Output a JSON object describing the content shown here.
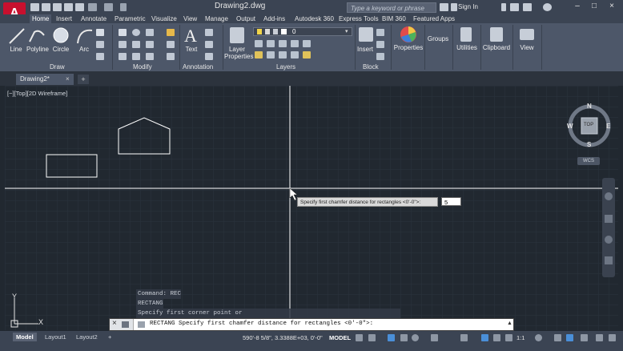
{
  "app": {
    "logo_letter": "A",
    "document_title": "Drawing2.dwg",
    "search_placeholder": "Type a keyword or phrase",
    "signin_label": "Sign In"
  },
  "ribbon_tabs": [
    "Home",
    "Insert",
    "Annotate",
    "Parametric",
    "Visualize",
    "View",
    "Manage",
    "Output",
    "Add-ins",
    "Autodesk 360",
    "Express Tools",
    "BIM 360",
    "Featured Apps"
  ],
  "active_ribbon_tab": "Home",
  "draw_panel": {
    "tools": [
      "Line",
      "Polyline",
      "Circle",
      "Arc"
    ],
    "title": "Draw"
  },
  "modify_panel": {
    "title": "Modify"
  },
  "annotation_panel": {
    "text_label": "Text",
    "title": "Annotation"
  },
  "layers_panel": {
    "layer_properties_label": "Layer Properties",
    "current_layer": "0",
    "title": "Layers"
  },
  "block_panel": {
    "insert_label": "Insert",
    "title": "Block"
  },
  "single_tools": {
    "properties": "Properties",
    "groups": "Groups",
    "utilities": "Utilities",
    "clipboard": "Clipboard",
    "view": "View"
  },
  "document_tab": {
    "name": "Drawing2*",
    "close": "×",
    "new_tab": "+"
  },
  "viewport": {
    "label": "[−][Top][2D Wireframe]",
    "compass": {
      "n": "N",
      "s": "S",
      "e": "E",
      "w": "W",
      "top": "TOP"
    },
    "ucs_label": "WCS",
    "ucs_axis_x": "X",
    "ucs_axis_y": "Y"
  },
  "dynamic_input": {
    "prompt": "Specify first chamfer distance for rectangles <0'-0\">:",
    "value": "5"
  },
  "command_history": [
    "Command: REC",
    "RECTANG",
    "Specify first corner point or [Chamfer/Elevation/Fillet/Thickness/Width]: c"
  ],
  "command_line": {
    "command": "RECTANG",
    "text": "Specify first chamfer distance for rectangles <0'-0\">:",
    "close_icon": "×"
  },
  "layout_tabs": [
    "Model",
    "Layout1",
    "Layout2"
  ],
  "active_layout_tab": "Model",
  "status": {
    "coordinates": "590'-8 5/8\", 3.3388E+03, 0'-0\"",
    "space": "MODEL",
    "scale": "1:1"
  },
  "colors": {
    "accent": "#c8102e",
    "background": "#212830",
    "ribbon": "#4d5769",
    "crosshair": "#ffffff"
  }
}
